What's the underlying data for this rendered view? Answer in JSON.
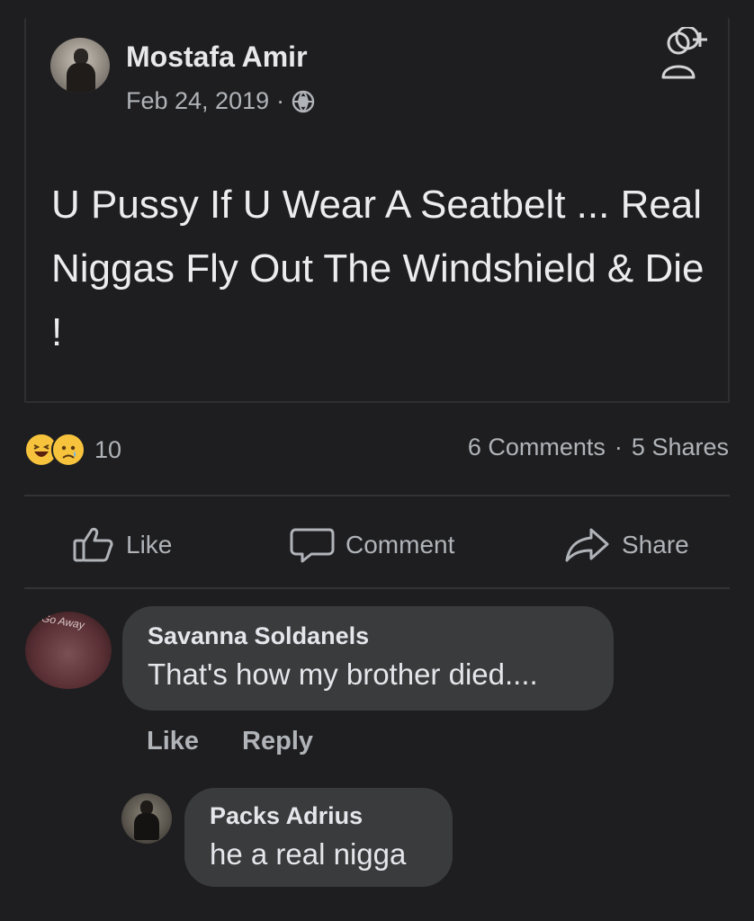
{
  "post": {
    "author": "Mostafa Amir",
    "date": "Feb 24, 2019",
    "meta_separator": "·",
    "privacy_icon": "globe-icon",
    "add_friend_icon": "add-friend-icon",
    "text": "U Pussy If U Wear A Seatbelt ... Real Niggas Fly Out The Windshield & Die !"
  },
  "reactions": {
    "emojis": [
      "haha-emoji",
      "sad-emoji"
    ],
    "count": "10"
  },
  "stats": {
    "comments": "6 Comments",
    "separator": "·",
    "shares": "5 Shares"
  },
  "actions": {
    "like": "Like",
    "comment": "Comment",
    "share": "Share"
  },
  "comments": [
    {
      "avatar_text": "Go Away",
      "author": "Savanna Soldanels",
      "text": "That's how my brother died....",
      "like_label": "Like",
      "reply_label": "Reply"
    },
    {
      "author": "Packs Adrius",
      "text": "he a real nigga"
    }
  ],
  "colors": {
    "background": "#1e1e20",
    "bubble": "#3a3b3c",
    "secondary_text": "#b0b3b8",
    "reaction_yellow": "#f7c33d"
  }
}
